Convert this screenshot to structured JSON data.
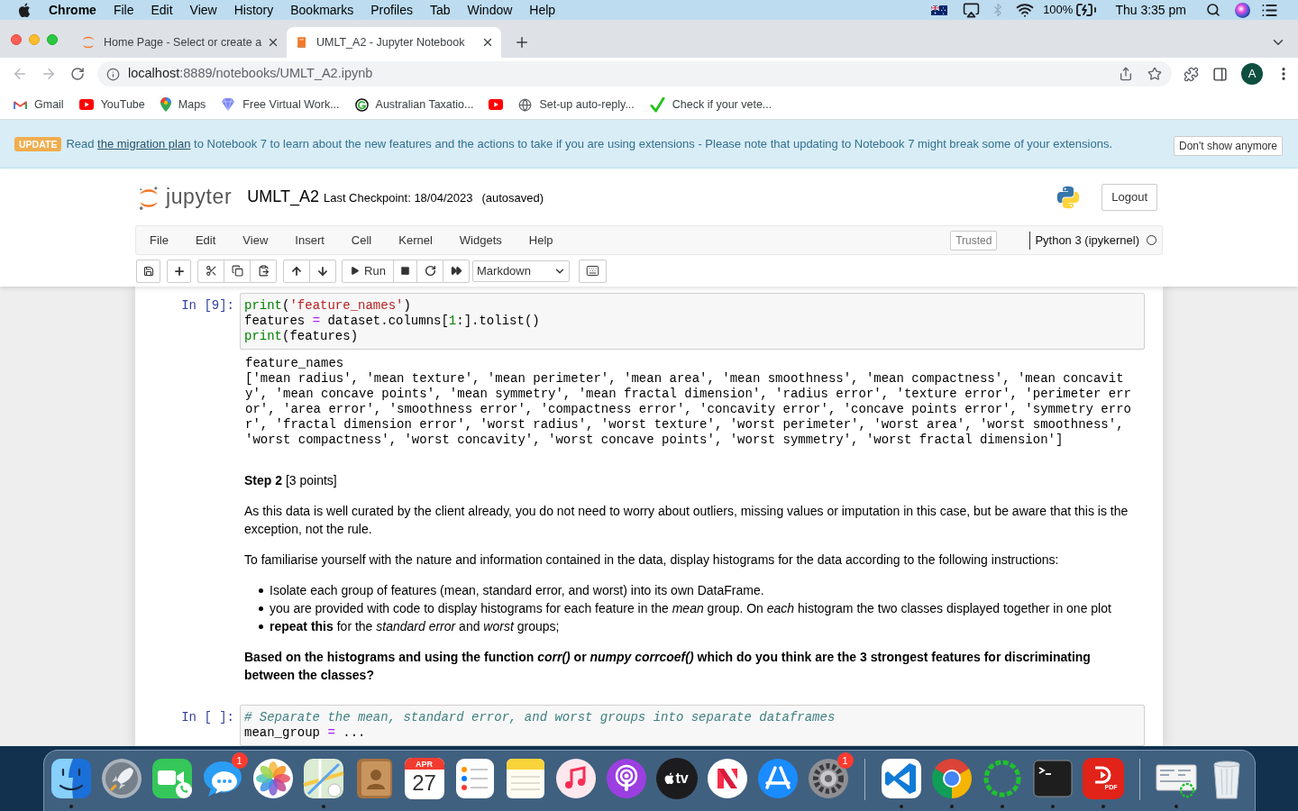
{
  "menu_bar": {
    "app": "Chrome",
    "items": [
      "File",
      "Edit",
      "View",
      "History",
      "Bookmarks",
      "Profiles",
      "Tab",
      "Window",
      "Help"
    ],
    "bluetooth_on": false,
    "battery": "100%",
    "clock": "Thu 3:35 pm"
  },
  "tabs": [
    {
      "kind": "jupyter",
      "title": "Home Page - Select or create a",
      "selected": false
    },
    {
      "kind": "notebook",
      "title": "UMLT_A2 - Jupyter Notebook",
      "selected": true
    }
  ],
  "address_bar": {
    "host": "localhost",
    "path": ":8889/notebooks/UMLT_A2.ipynb"
  },
  "profile_initial": "A",
  "bookmarks": [
    {
      "kind": "gmail",
      "label": "Gmail"
    },
    {
      "kind": "youtube",
      "label": "YouTube"
    },
    {
      "kind": "maps",
      "label": "Maps"
    },
    {
      "kind": "gem",
      "label": "Free Virtual Work..."
    },
    {
      "kind": "g",
      "label": "Australian Taxatio..."
    },
    {
      "kind": "youtube"
    },
    {
      "kind": "globe",
      "label": "Set-up auto-reply..."
    },
    {
      "kind": "check",
      "label": "Check if your vete..."
    }
  ],
  "banner": {
    "badge": "UPDATE",
    "before": "Read ",
    "link": "the migration plan",
    "after": " to Notebook 7 to learn about the new features and the actions to take if you are using extensions - Please note that updating to Notebook 7 might break some of your extensions.",
    "button": "Don't show anymore"
  },
  "notebook": {
    "logo_text": "jupyter",
    "title": "UMLT_A2",
    "checkpoint": "Last Checkpoint: 18/04/2023",
    "autosave": "(autosaved)",
    "logout": "Logout",
    "menu": [
      "File",
      "Edit",
      "View",
      "Insert",
      "Cell",
      "Kernel",
      "Widgets",
      "Help"
    ],
    "trusted": "Trusted",
    "kernel": {
      "name": "Python 3 (ipykernel)",
      "busy": false
    },
    "toolbar": {
      "run": "Run",
      "cell_type": "Markdown"
    }
  },
  "cells": [
    {
      "kind": "code",
      "prompt": "In [9]:",
      "lines": [
        [
          {
            "kind": "builtin",
            "text": "print"
          },
          {
            "kind": "plain",
            "text": "("
          },
          {
            "kind": "string",
            "text": "'feature_names'"
          },
          {
            "kind": "plain",
            "text": ")"
          }
        ],
        [
          {
            "kind": "plain",
            "text": "features "
          },
          {
            "kind": "operator",
            "text": "="
          },
          {
            "kind": "plain",
            "text": " dataset.columns["
          },
          {
            "kind": "number",
            "text": "1"
          },
          {
            "kind": "plain",
            "text": ":].tolist()"
          }
        ],
        [
          {
            "kind": "builtin",
            "text": "print"
          },
          {
            "kind": "plain",
            "text": "(features)"
          }
        ]
      ],
      "output": [
        "feature_names",
        "['mean radius', 'mean texture', 'mean perimeter', 'mean area', 'mean smoothness', 'mean compactness', 'mean concavit",
        "y', 'mean concave points', 'mean symmetry', 'mean fractal dimension', 'radius error', 'texture error', 'perimeter err",
        "or', 'area error', 'smoothness error', 'compactness error', 'concavity error', 'concave points error', 'symmetry erro",
        "r', 'fractal dimension error', 'worst radius', 'worst texture', 'worst perimeter', 'worst area', 'worst smoothness',",
        "'worst compactness', 'worst concavity', 'worst concave points', 'worst symmetry', 'worst fractal dimension']"
      ]
    },
    {
      "kind": "markdown",
      "blocks": [
        {
          "kind": "paragraph",
          "text": "**Step 2** [3 points]"
        },
        {
          "kind": "paragraph",
          "text": "As this data is well curated by the client already, you do not need to worry about outliers, missing values or imputation in this case, but be aware that this is the exception, not the rule."
        },
        {
          "kind": "paragraph",
          "text": "To familiarise yourself with the nature and information contained in the data, display histograms for the data according to the following instructions:"
        },
        {
          "kind": "list",
          "items": [
            "Isolate each group of features (mean, standard error, and worst) into its own DataFrame.",
            "you are provided with code to display histograms for each feature in the *mean* group. On *each* histogram the two classes displayed together in one plot",
            "**repeat this** for the *standard error* and *worst* groups;"
          ]
        },
        {
          "kind": "paragraph",
          "bold": true,
          "text": "Based on the histograms and using the function *corr()* or *numpy corrcoef()* which do you think are the 3 strongest features for discriminating between the classes?"
        }
      ]
    },
    {
      "kind": "code",
      "prompt": "In [ ]:",
      "lines": [
        [
          {
            "kind": "comment",
            "text": "# Separate the mean, standard error, and worst groups into separate dataframes"
          }
        ],
        [
          {
            "kind": "plain",
            "text": "mean_group "
          },
          {
            "kind": "operator",
            "text": "="
          },
          {
            "kind": "plain",
            "text": " ..."
          }
        ]
      ]
    }
  ],
  "dock": [
    {
      "kind": "finder",
      "running": true
    },
    {
      "kind": "launchpad",
      "running": false
    },
    {
      "kind": "facetime",
      "running": false
    },
    {
      "kind": "messages",
      "running": false,
      "badge": "1"
    },
    {
      "kind": "photos",
      "running": false
    },
    {
      "kind": "maps",
      "running": true
    },
    {
      "kind": "contacts",
      "running": false
    },
    {
      "kind": "calendar",
      "running": false,
      "month": "APR",
      "day": "27"
    },
    {
      "kind": "reminders",
      "running": false
    },
    {
      "kind": "notes",
      "running": false
    },
    {
      "kind": "music",
      "running": false
    },
    {
      "kind": "podcasts",
      "running": false
    },
    {
      "kind": "tv",
      "running": false,
      "label": "tv"
    },
    {
      "kind": "news",
      "running": false
    },
    {
      "kind": "appstore",
      "running": false
    },
    {
      "kind": "settings",
      "running": false,
      "badge": "1"
    },
    {
      "kind": "separator"
    },
    {
      "kind": "vscode",
      "running": true
    },
    {
      "kind": "chrome",
      "running": true
    },
    {
      "kind": "ring",
      "running": true
    },
    {
      "kind": "terminal",
      "running": true
    },
    {
      "kind": "pdf",
      "running": true,
      "label": "PDF"
    },
    {
      "kind": "separator"
    },
    {
      "kind": "thumbnail",
      "running": true
    },
    {
      "kind": "trash",
      "running": false
    }
  ]
}
